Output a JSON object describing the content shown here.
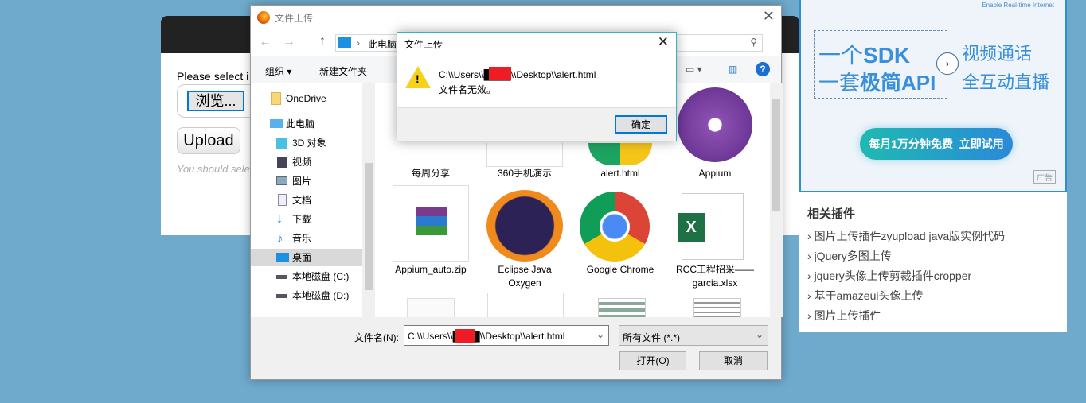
{
  "page": {
    "prompt": "Please select i",
    "browse_label": "浏览...",
    "upload_label": "Upload",
    "hint": "You should sele"
  },
  "ad": {
    "tagline": "Enable Real-time Internet",
    "line1a": "一个",
    "line1b": "SDK",
    "line2a": "一套",
    "line2b": "极简API",
    "right1": "视频通话",
    "right2": "全互动直播",
    "cta": "每月1万分钟免费  立即试用",
    "badge": "广告"
  },
  "related": {
    "title": "相关插件",
    "items": [
      "图片上传插件zyupload java版实例代码",
      "jQuery多图上传",
      "jquery头像上传剪裁插件cropper",
      "基于amazeui头像上传",
      "图片上传插件"
    ]
  },
  "file_dialog": {
    "title": "文件上传",
    "breadcrumb": "此电脑",
    "toolbar": {
      "organize": "组织",
      "new_folder": "新建文件夹"
    },
    "nav": [
      "OneDrive",
      "此电脑",
      "3D 对象",
      "视频",
      "图片",
      "文档",
      "下载",
      "音乐",
      "桌面",
      "本地磁盘 (C:)",
      "本地磁盘 (D:)"
    ],
    "files": [
      "每周分享",
      "360手机演示",
      "alert.html",
      "Appium",
      "Appium_auto.zip",
      "Eclipse Java Oxygen",
      "Google Chrome",
      "RCC工程招采——garcia.xlsx"
    ],
    "filename_label": "文件名(N):",
    "filename_value": "C:\\\\Users\\\\████\\\\Desktop\\\\alert.html",
    "filter": "所有文件 (*.*)",
    "open": "打开(O)",
    "cancel": "取消"
  },
  "alert": {
    "title": "文件上传",
    "path": "C:\\\\Users\\\\████\\\\Desktop\\\\alert.html",
    "message": "文件名无效。",
    "ok": "确定"
  },
  "colors": {
    "background": "#6fa9cc",
    "accent": "#0078d7",
    "redaction": "#ee1c25"
  }
}
